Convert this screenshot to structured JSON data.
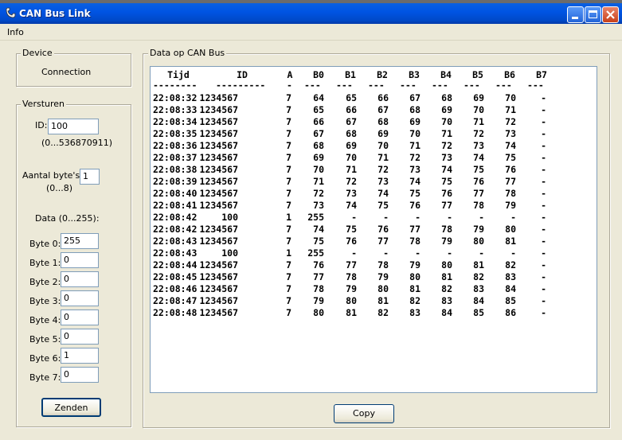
{
  "window": {
    "title": "CAN Bus Link"
  },
  "menu": {
    "items": [
      "Info"
    ]
  },
  "device": {
    "group_title": "Device",
    "connection_label": "Connection"
  },
  "send": {
    "group_title": "Versturen",
    "id_label": "ID:",
    "id_value": "100",
    "id_range": "(0...536870911)",
    "count_label": "Aantal byte's:",
    "count_range": "(0...8)",
    "count_value": "1",
    "data_label": "Data (0...255):",
    "bytes": [
      {
        "label": "Byte 0:",
        "value": "255"
      },
      {
        "label": "Byte 1:",
        "value": "0"
      },
      {
        "label": "Byte 2:",
        "value": "0"
      },
      {
        "label": "Byte 3:",
        "value": "0"
      },
      {
        "label": "Byte 4:",
        "value": "0"
      },
      {
        "label": "Byte 5:",
        "value": "0"
      },
      {
        "label": "Byte 6:",
        "value": "1"
      },
      {
        "label": "Byte 7:",
        "value": "0"
      }
    ],
    "send_button": "Zenden"
  },
  "data": {
    "group_title": "Data op CAN Bus",
    "columns": [
      "Tijd",
      "ID",
      "A",
      "B0",
      "B1",
      "B2",
      "B3",
      "B4",
      "B5",
      "B6",
      "B7"
    ],
    "underlines": [
      "--------",
      "---------",
      "-",
      "---",
      "---",
      "---",
      "---",
      "---",
      "---",
      "---",
      "---"
    ],
    "rows": [
      [
        "22:08:32",
        "1234567",
        "7",
        "64",
        "65",
        "66",
        "67",
        "68",
        "69",
        "70",
        "-"
      ],
      [
        "22:08:33",
        "1234567",
        "7",
        "65",
        "66",
        "67",
        "68",
        "69",
        "70",
        "71",
        "-"
      ],
      [
        "22:08:34",
        "1234567",
        "7",
        "66",
        "67",
        "68",
        "69",
        "70",
        "71",
        "72",
        "-"
      ],
      [
        "22:08:35",
        "1234567",
        "7",
        "67",
        "68",
        "69",
        "70",
        "71",
        "72",
        "73",
        "-"
      ],
      [
        "22:08:36",
        "1234567",
        "7",
        "68",
        "69",
        "70",
        "71",
        "72",
        "73",
        "74",
        "-"
      ],
      [
        "22:08:37",
        "1234567",
        "7",
        "69",
        "70",
        "71",
        "72",
        "73",
        "74",
        "75",
        "-"
      ],
      [
        "22:08:38",
        "1234567",
        "7",
        "70",
        "71",
        "72",
        "73",
        "74",
        "75",
        "76",
        "-"
      ],
      [
        "22:08:39",
        "1234567",
        "7",
        "71",
        "72",
        "73",
        "74",
        "75",
        "76",
        "77",
        "-"
      ],
      [
        "22:08:40",
        "1234567",
        "7",
        "72",
        "73",
        "74",
        "75",
        "76",
        "77",
        "78",
        "-"
      ],
      [
        "22:08:41",
        "1234567",
        "7",
        "73",
        "74",
        "75",
        "76",
        "77",
        "78",
        "79",
        "-"
      ],
      [
        "22:08:42",
        "100",
        "1",
        "255",
        "-",
        "-",
        "-",
        "-",
        "-",
        "-",
        "-"
      ],
      [
        "22:08:42",
        "1234567",
        "7",
        "74",
        "75",
        "76",
        "77",
        "78",
        "79",
        "80",
        "-"
      ],
      [
        "22:08:43",
        "1234567",
        "7",
        "75",
        "76",
        "77",
        "78",
        "79",
        "80",
        "81",
        "-"
      ],
      [
        "22:08:43",
        "100",
        "1",
        "255",
        "-",
        "-",
        "-",
        "-",
        "-",
        "-",
        "-"
      ],
      [
        "22:08:44",
        "1234567",
        "7",
        "76",
        "77",
        "78",
        "79",
        "80",
        "81",
        "82",
        "-"
      ],
      [
        "22:08:45",
        "1234567",
        "7",
        "77",
        "78",
        "79",
        "80",
        "81",
        "82",
        "83",
        "-"
      ],
      [
        "22:08:46",
        "1234567",
        "7",
        "78",
        "79",
        "80",
        "81",
        "82",
        "83",
        "84",
        "-"
      ],
      [
        "22:08:47",
        "1234567",
        "7",
        "79",
        "80",
        "81",
        "82",
        "83",
        "84",
        "85",
        "-"
      ],
      [
        "22:08:48",
        "1234567",
        "7",
        "80",
        "81",
        "82",
        "83",
        "84",
        "85",
        "86",
        "-"
      ]
    ],
    "copy_button": "Copy"
  }
}
